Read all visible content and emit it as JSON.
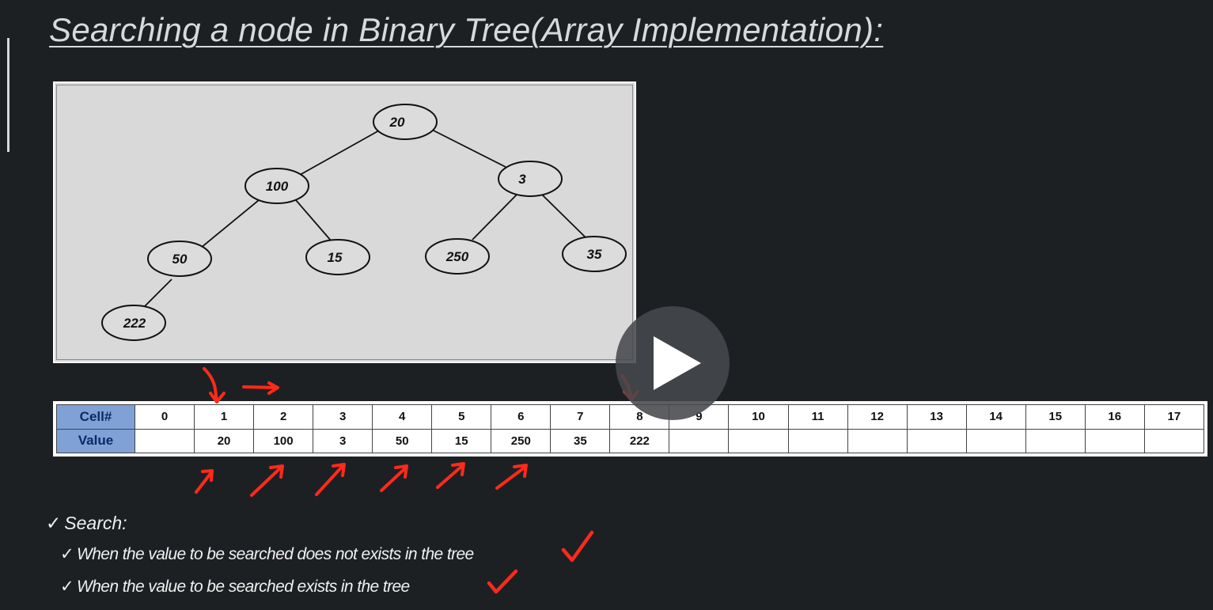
{
  "slide": {
    "title": "Searching a node in Binary Tree(Array Implementation):"
  },
  "tree": {
    "nodes": [
      {
        "id": "n20",
        "label": "20"
      },
      {
        "id": "n100",
        "label": "100"
      },
      {
        "id": "n3",
        "label": "3"
      },
      {
        "id": "n50",
        "label": "50"
      },
      {
        "id": "n15",
        "label": "15"
      },
      {
        "id": "n250",
        "label": "250"
      },
      {
        "id": "n35",
        "label": "35"
      },
      {
        "id": "n222",
        "label": "222"
      }
    ],
    "edges": [
      [
        "n20",
        "n100"
      ],
      [
        "n20",
        "n3"
      ],
      [
        "n100",
        "n50"
      ],
      [
        "n100",
        "n15"
      ],
      [
        "n3",
        "n250"
      ],
      [
        "n3",
        "n35"
      ],
      [
        "n50",
        "n222"
      ]
    ]
  },
  "array_table": {
    "row_headers": [
      "Cell#",
      "Value"
    ],
    "cells": [
      "0",
      "1",
      "2",
      "3",
      "4",
      "5",
      "6",
      "7",
      "8",
      "9",
      "10",
      "11",
      "12",
      "13",
      "14",
      "15",
      "16",
      "17"
    ],
    "values": [
      "",
      "20",
      "100",
      "3",
      "50",
      "15",
      "250",
      "35",
      "222",
      "",
      "",
      "",
      "",
      "",
      "",
      "",
      "",
      ""
    ],
    "header_color": "#7fa1d6"
  },
  "bullets": {
    "main": "Search:",
    "items": [
      "When the value to be searched does not exists in the tree",
      "When the value to be searched exists in the tree"
    ]
  },
  "annotation_color": "#ff2a1a",
  "icons": {
    "check": "✓",
    "play": "play-icon"
  }
}
